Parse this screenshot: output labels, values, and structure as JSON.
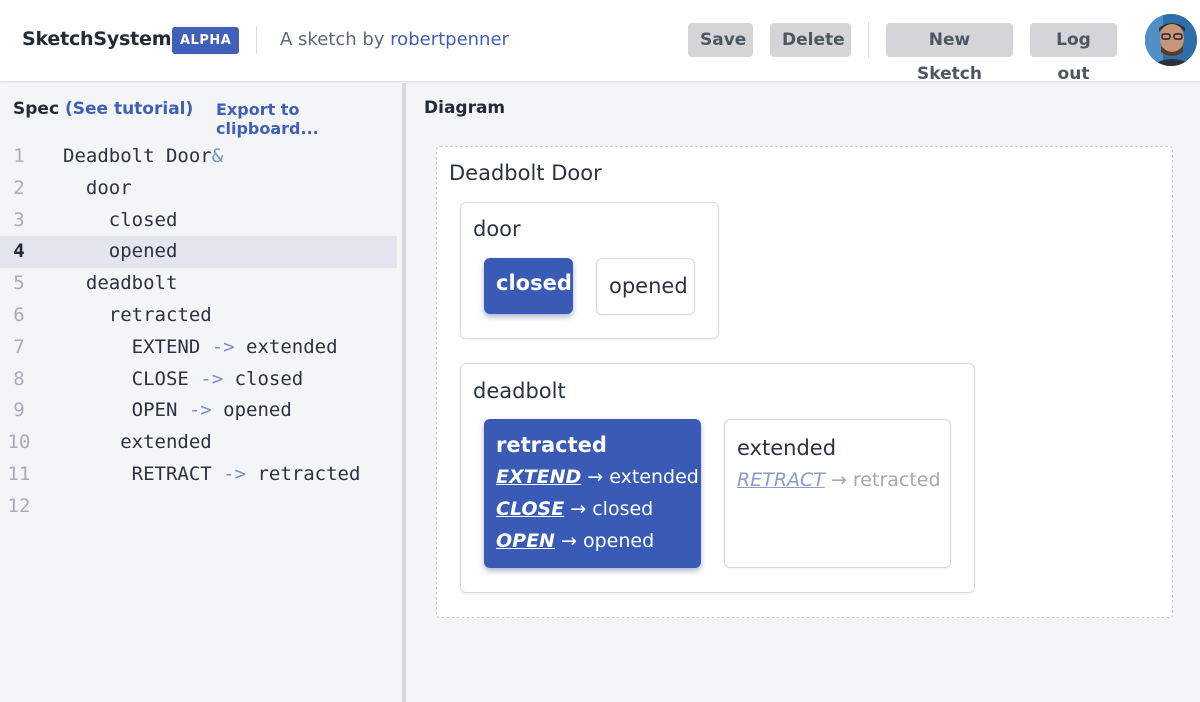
{
  "header": {
    "brand": "SketchSystems",
    "badge": "ALPHA",
    "byline_prefix": "A sketch by",
    "author": "robertpenner",
    "buttons": {
      "save": "Save",
      "delete": "Delete",
      "new_sketch": "New Sketch",
      "log_out": "Log out"
    }
  },
  "spec": {
    "title": "Spec",
    "tutorial_link": "(See tutorial)",
    "export_link": "Export to clipboard...",
    "active_line": 4,
    "lines": [
      {
        "n": "1",
        "text": "Deadbolt Door",
        "suffix": "&"
      },
      {
        "n": "2",
        "text": "  door"
      },
      {
        "n": "3",
        "text": "    closed"
      },
      {
        "n": "4",
        "text": "    opened"
      },
      {
        "n": "5",
        "text": "  deadbolt"
      },
      {
        "n": "6",
        "text": "    retracted"
      },
      {
        "n": "7",
        "text": "      EXTEND ",
        "arrow": "->",
        "target": " extended"
      },
      {
        "n": "8",
        "text": "      CLOSE ",
        "arrow": "->",
        "target": " closed"
      },
      {
        "n": "9",
        "text": "      OPEN ",
        "arrow": "->",
        "target": " opened"
      },
      {
        "n": "10",
        "text": "     extended"
      },
      {
        "n": "11",
        "text": "      RETRACT ",
        "arrow": "->",
        "target": " retracted"
      },
      {
        "n": "12",
        "text": ""
      }
    ]
  },
  "diagram": {
    "title": "Diagram",
    "machine": "Deadbolt Door",
    "regions": {
      "door": {
        "label": "door",
        "states": {
          "closed": "closed",
          "opened": "opened"
        }
      },
      "deadbolt": {
        "label": "deadbolt",
        "retracted": {
          "name": "retracted",
          "transitions": [
            {
              "event": "EXTEND",
              "arrow": "→",
              "target": "extended"
            },
            {
              "event": "CLOSE",
              "arrow": "→",
              "target": "closed"
            },
            {
              "event": "OPEN",
              "arrow": "→",
              "target": "opened"
            }
          ]
        },
        "extended": {
          "name": "extended",
          "transitions": [
            {
              "event": "RETRACT",
              "arrow": "→",
              "target": "retracted"
            }
          ]
        }
      }
    }
  },
  "colors": {
    "accent": "#3a5bb5",
    "button_bg": "#d3d5d9",
    "active_line_bg": "#e3e6ee"
  }
}
